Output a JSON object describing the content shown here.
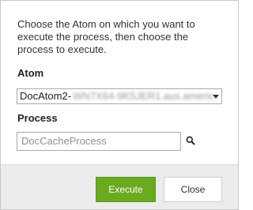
{
  "dialog": {
    "intro_text": "Choose the Atom on which you want to execute the process, then choose the process to execute.",
    "atom": {
      "label": "Atom",
      "selected_prefix": "DocAtom2-",
      "selected_obscured": "WN7X64-9K5JER1.aus.americ"
    },
    "process": {
      "label": "Process",
      "value": "DocCacheProcess"
    },
    "buttons": {
      "execute": "Execute",
      "close": "Close"
    },
    "colors": {
      "execute_bg": "#6aaa1e",
      "footer_bg": "#ececec"
    },
    "icons": {
      "search": "search-icon",
      "dropdown": "chevron-down-icon"
    }
  }
}
